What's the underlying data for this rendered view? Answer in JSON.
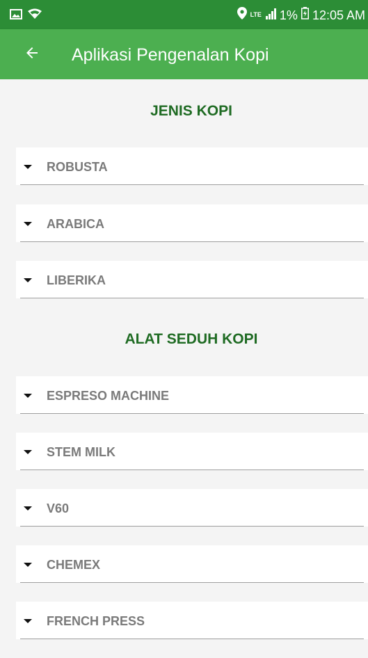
{
  "status_bar": {
    "lte": "LTE",
    "battery": "1%",
    "time": "12:05 AM",
    "icons": [
      "image-icon",
      "wifi-icon",
      "location-icon",
      "signal-icon",
      "battery-icon"
    ]
  },
  "app_bar": {
    "title": "Aplikasi Pengenalan Kopi",
    "back_icon": "arrow-left-icon",
    "color": "#4caf50"
  },
  "sections": [
    {
      "title": "JENIS KOPI",
      "items": [
        "ROBUSTA",
        "ARABICA",
        "LIBERIKA"
      ]
    },
    {
      "title": "ALAT SEDUH KOPI",
      "items": [
        "ESPRESO MACHINE",
        "STEM MILK",
        "V60",
        "CHEMEX",
        "FRENCH PRESS"
      ]
    }
  ],
  "colors": {
    "status_bar": "#2c8d36",
    "section_title": "#1f6b23",
    "item_label": "#7a7a7a"
  }
}
